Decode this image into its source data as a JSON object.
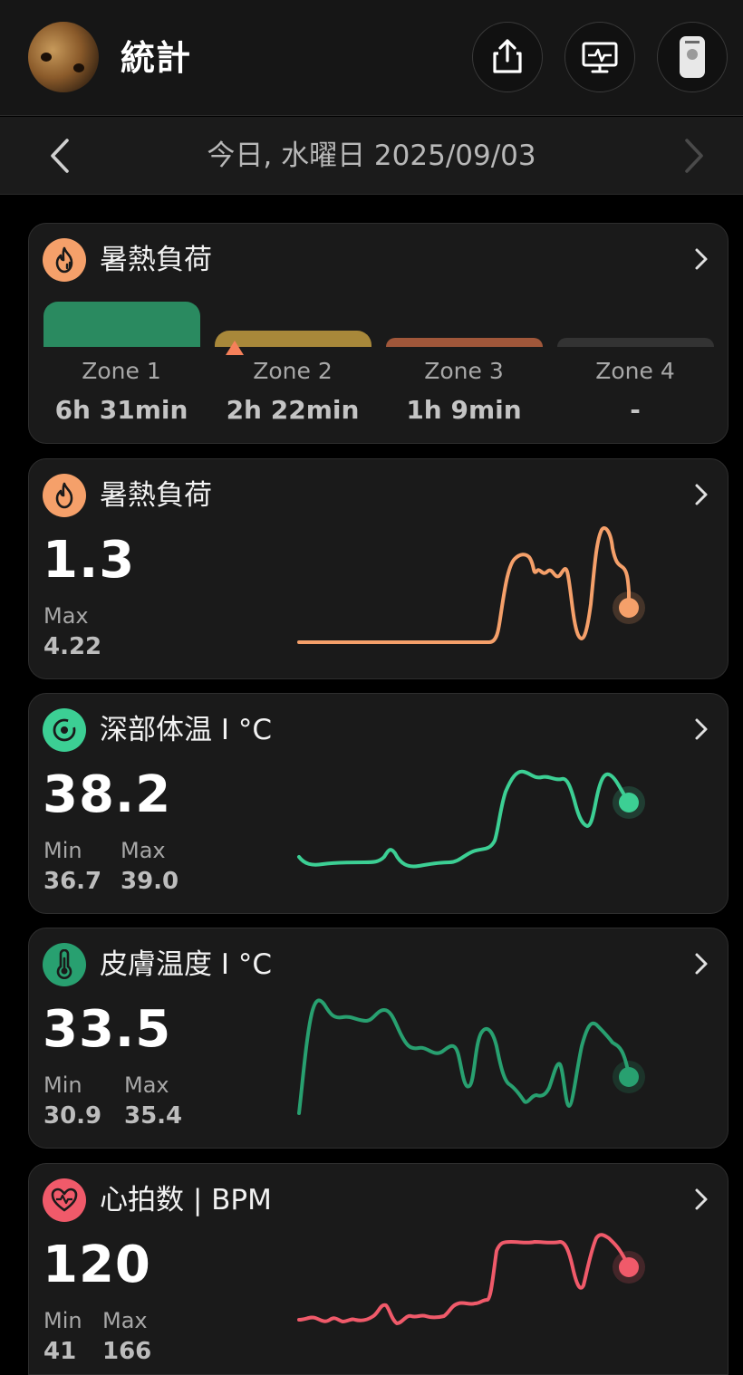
{
  "header": {
    "title": "統計",
    "avatar": "dog-photo",
    "buttons": [
      "share-icon",
      "monitor-icon",
      "device-icon"
    ]
  },
  "datebar": {
    "date": "今日, 水曜日 2025/09/03"
  },
  "heat_zones": {
    "title": "暑熱負荷",
    "icon": "heat-stress-icon",
    "zones": [
      {
        "label": "Zone 1",
        "value": "6h 31min",
        "color": "#2a8a60"
      },
      {
        "label": "Zone 2",
        "value": "2h 22min",
        "color": "#a8883a"
      },
      {
        "label": "Zone 3",
        "value": "1h 9min",
        "color": "#a0573a"
      },
      {
        "label": "Zone 4",
        "value": "-",
        "color": "#3a3a3a"
      }
    ],
    "current_zone": 2
  },
  "heat_load": {
    "title": "暑熱負荷",
    "icon": "flame-icon",
    "value": "1.3",
    "max_label": "Max",
    "max_value": "4.22",
    "color": "#f5a06a"
  },
  "core_temp": {
    "title": "深部体温 I °C",
    "icon": "core-temp-icon",
    "value": "38.2",
    "min_label": "Min",
    "min_value": "36.7",
    "max_label": "Max",
    "max_value": "39.0",
    "color": "#3ccf94"
  },
  "skin_temp": {
    "title": "皮膚温度 I °C",
    "icon": "thermometer-icon",
    "value": "33.5",
    "min_label": "Min",
    "min_value": "30.9",
    "max_label": "Max",
    "max_value": "35.4",
    "color": "#28a070"
  },
  "heart_rate": {
    "title": "心拍数 | BPM",
    "icon": "heart-icon",
    "value": "120",
    "min_label": "Min",
    "min_value": "41",
    "max_label": "Max",
    "max_value": "166",
    "color": "#f05a6a"
  }
}
